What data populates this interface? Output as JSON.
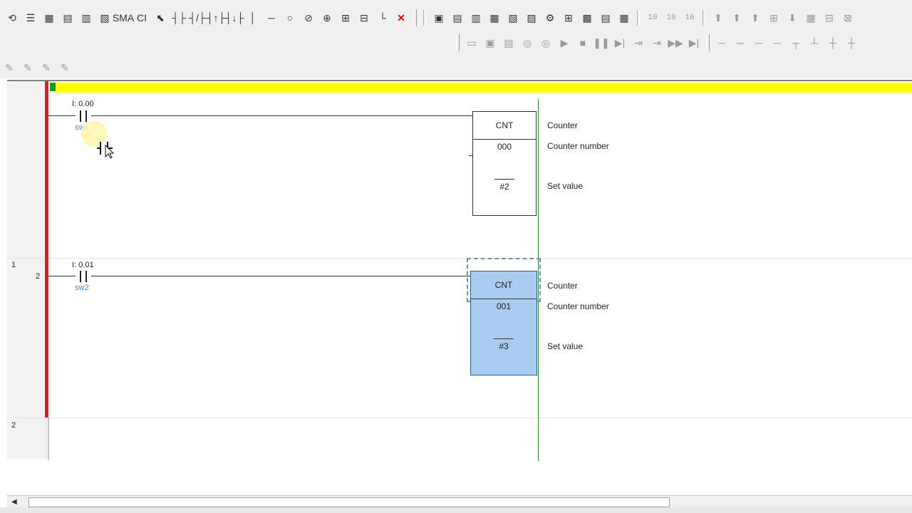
{
  "toolbar": {
    "row1": [
      "⟲",
      "☰",
      "▦",
      "▤",
      "▥",
      "▧",
      "SMA",
      "CI",
      "⬉",
      "┤├",
      "┤/├",
      "┤↑├",
      "┤↓├",
      "│",
      "─",
      "○",
      "⊘",
      "⊕",
      "⊞",
      "⊟",
      "└",
      "✕"
    ],
    "row1b": [
      "▣",
      "▤",
      "▥",
      "▦",
      "▧",
      "▨",
      "⚙",
      "⊞",
      "▩",
      "▤",
      "▦"
    ],
    "nums": [
      "10",
      "10",
      "16"
    ],
    "row1c": [
      "⬆",
      "⬆",
      "⬆",
      "⊞",
      "⬇",
      "▦",
      "⊟",
      "⊠"
    ],
    "row2": [
      "▭",
      "▣",
      "▤",
      "◎",
      "◎",
      "▶",
      "■",
      "❚❚",
      "▶|",
      "⇥",
      "⇥",
      "▶▶",
      "▶|"
    ],
    "row2b": [
      "─",
      "─",
      "─",
      "─",
      "┬",
      "┴",
      "┼",
      "┼"
    ],
    "row3": [
      "✎",
      "✎",
      "✎",
      "✎"
    ]
  },
  "colors": {
    "power_rail": "#d32222",
    "rung_bar": "#ffff00",
    "selection": "#a8cdf0",
    "symbol": "#3a8fd0",
    "right_rail": "#2a8a2a"
  },
  "rungs": [
    {
      "margin_number": "",
      "step_number": "",
      "contact": {
        "address": "I: 0.00",
        "symbol": "sw1"
      },
      "instruction": {
        "name": "CNT",
        "operand1": "000",
        "operand2": "#2",
        "selected": false
      },
      "comments": {
        "name": "Counter",
        "op1": "Counter number",
        "op2": "Set value"
      }
    },
    {
      "margin_number": "1",
      "step_number": "2",
      "contact": {
        "address": "I: 0.01",
        "symbol": "sw2"
      },
      "instruction": {
        "name": "CNT",
        "operand1": "001",
        "operand2": "#3",
        "selected": true
      },
      "comments": {
        "name": "Counter",
        "op1": "Counter number",
        "op2": "Set value"
      }
    },
    {
      "margin_number": "2"
    }
  ],
  "scrollbar": {
    "left_arrow": "◀"
  }
}
